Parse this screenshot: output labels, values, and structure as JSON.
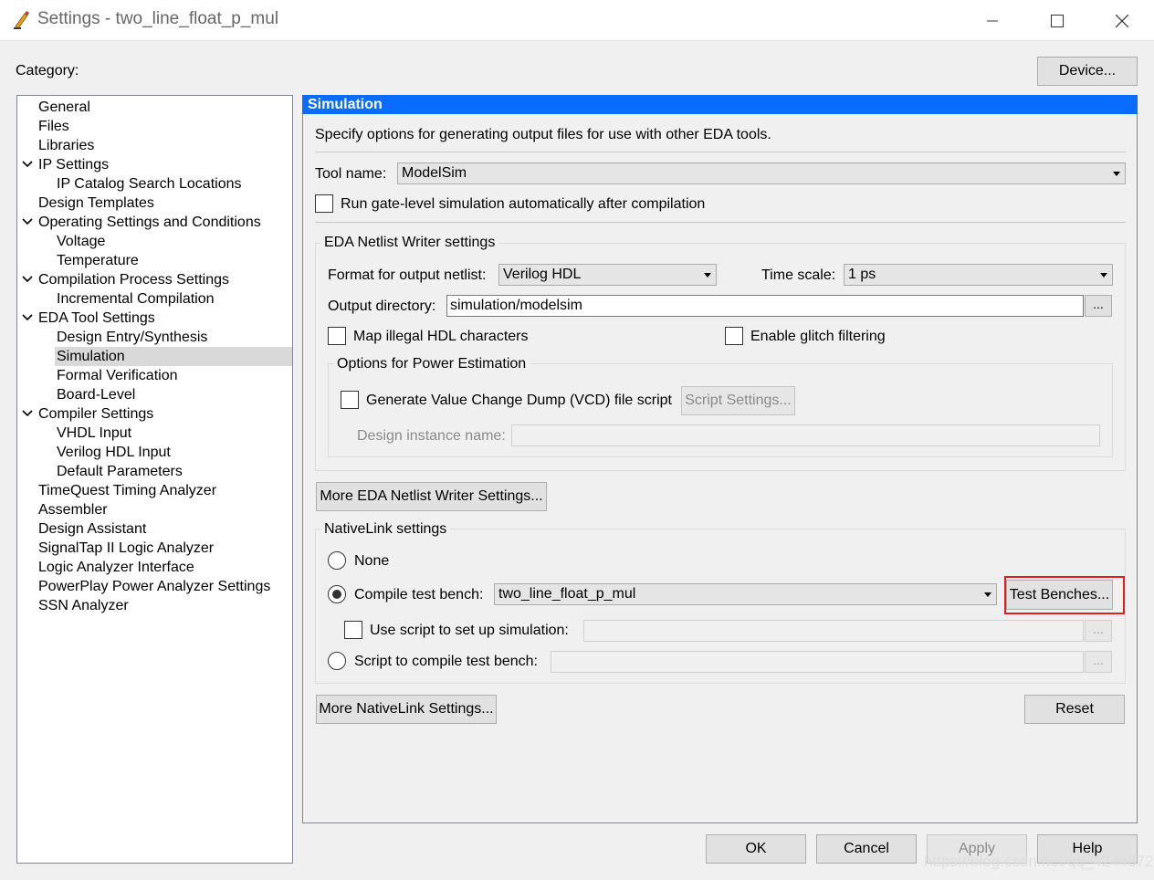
{
  "window": {
    "title": "Settings - two_line_float_p_mul"
  },
  "header": {
    "category_label": "Category:",
    "device_button": "Device..."
  },
  "tree": {
    "items": [
      {
        "label": "General"
      },
      {
        "label": "Files"
      },
      {
        "label": "Libraries"
      },
      {
        "label": "IP Settings"
      },
      {
        "label": "IP Catalog Search Locations"
      },
      {
        "label": "Design Templates"
      },
      {
        "label": "Operating Settings and Conditions"
      },
      {
        "label": "Voltage"
      },
      {
        "label": "Temperature"
      },
      {
        "label": "Compilation Process Settings"
      },
      {
        "label": "Incremental Compilation"
      },
      {
        "label": "EDA Tool Settings"
      },
      {
        "label": "Design Entry/Synthesis"
      },
      {
        "label": "Simulation"
      },
      {
        "label": "Formal Verification"
      },
      {
        "label": "Board-Level"
      },
      {
        "label": "Compiler Settings"
      },
      {
        "label": "VHDL Input"
      },
      {
        "label": "Verilog HDL Input"
      },
      {
        "label": "Default Parameters"
      },
      {
        "label": "TimeQuest Timing Analyzer"
      },
      {
        "label": "Assembler"
      },
      {
        "label": "Design Assistant"
      },
      {
        "label": "SignalTap II Logic Analyzer"
      },
      {
        "label": "Logic Analyzer Interface"
      },
      {
        "label": "PowerPlay Power Analyzer Settings"
      },
      {
        "label": "SSN Analyzer"
      }
    ]
  },
  "panel": {
    "title": "Simulation",
    "description": "Specify options for generating output files for use with other EDA tools.",
    "tool_name_label": "Tool name:",
    "tool_name_value": "ModelSim",
    "run_gate_level_label": "Run gate-level simulation automatically after compilation",
    "netlist": {
      "group_title": "EDA Netlist Writer settings",
      "format_label": "Format for output netlist:",
      "format_value": "Verilog HDL",
      "timescale_label": "Time scale:",
      "timescale_value": "1 ps",
      "output_dir_label": "Output directory:",
      "output_dir_value": "simulation/modelsim",
      "browse_label": "...",
      "map_illegal_label": "Map illegal HDL characters",
      "glitch_label": "Enable glitch filtering",
      "power": {
        "group_title": "Options for Power Estimation",
        "vcd_label": "Generate Value Change Dump (VCD) file script",
        "script_settings_button": "Script Settings...",
        "instance_label": "Design instance name:"
      },
      "more_button": "More EDA Netlist Writer Settings..."
    },
    "nativelink": {
      "group_title": "NativeLink settings",
      "none_label": "None",
      "compile_tb_label": "Compile test bench:",
      "compile_tb_value": "two_line_float_p_mul",
      "test_benches_button": "Test Benches...",
      "use_script_label": "Use script to set up simulation:",
      "script_compile_label": "Script to compile test bench:",
      "browse_label": "...",
      "more_button": "More NativeLink Settings...",
      "reset_button": "Reset"
    }
  },
  "footer": {
    "ok": "OK",
    "cancel": "Cancel",
    "apply": "Apply",
    "help": "Help"
  },
  "watermark": "https://blog.csdn.net/qq_42446721"
}
